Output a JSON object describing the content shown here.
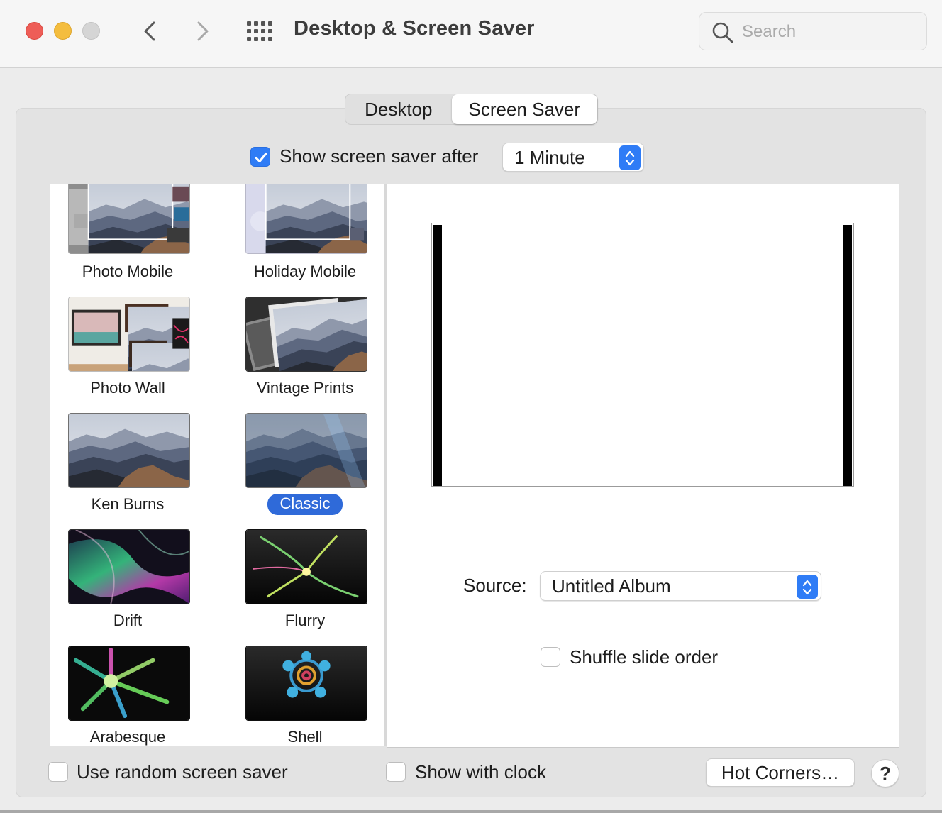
{
  "window": {
    "title": "Desktop & Screen Saver",
    "search_placeholder": "Search"
  },
  "tabs": [
    {
      "label": "Desktop",
      "selected": false
    },
    {
      "label": "Screen Saver",
      "selected": true
    }
  ],
  "start_after": {
    "checked": true,
    "label": "Show screen saver after",
    "value": "1 Minute"
  },
  "savers": [
    {
      "label": "Photo Mobile",
      "icon": "photo-mobile-thumbnail"
    },
    {
      "label": "Holiday Mobile",
      "icon": "holiday-mobile-thumbnail"
    },
    {
      "label": "Photo Wall",
      "icon": "photo-wall-thumbnail"
    },
    {
      "label": "Vintage Prints",
      "icon": "vintage-prints-thumbnail"
    },
    {
      "label": "Ken Burns",
      "icon": "ken-burns-thumbnail"
    },
    {
      "label": "Classic",
      "icon": "classic-thumbnail",
      "selected": true
    },
    {
      "label": "Drift",
      "icon": "drift-thumbnail"
    },
    {
      "label": "Flurry",
      "icon": "flurry-thumbnail"
    },
    {
      "label": "Arabesque",
      "icon": "arabesque-thumbnail"
    },
    {
      "label": "Shell",
      "icon": "shell-thumbnail"
    }
  ],
  "options": {
    "source_label": "Source:",
    "source_value": "Untitled Album",
    "shuffle_label": "Shuffle slide order",
    "shuffle_checked": false
  },
  "footer": {
    "random_label": "Use random screen saver",
    "random_checked": false,
    "clock_label": "Show with clock",
    "clock_checked": false,
    "hot_corners_label": "Hot Corners…",
    "help_label": "?"
  },
  "colors": {
    "accent": "#2f7cf6",
    "selection": "#2f6ad9",
    "close": "#ee5d57",
    "minimize": "#f4bd3e",
    "zoom_disabled": "#d5d5d5"
  }
}
